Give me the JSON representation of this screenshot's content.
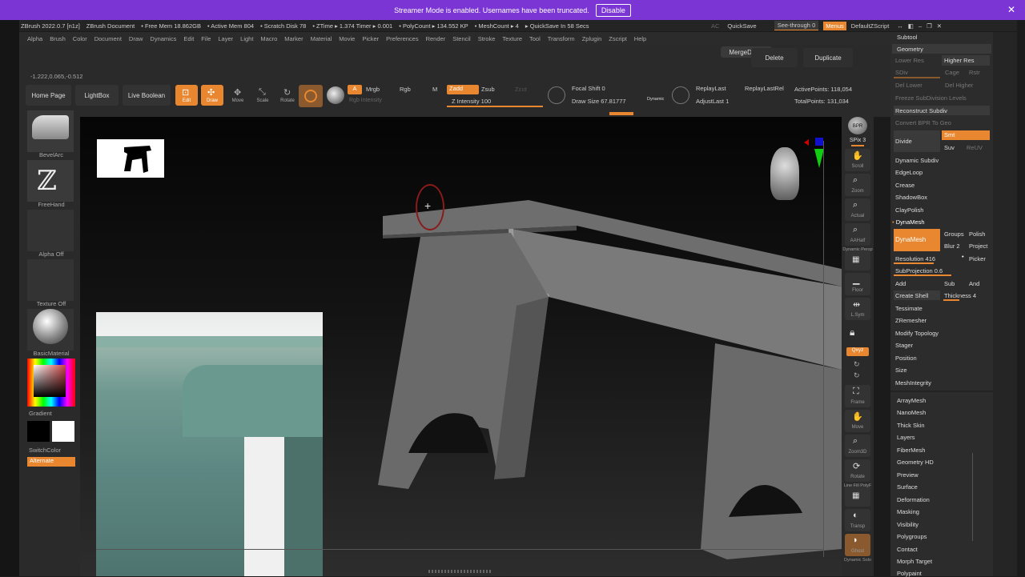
{
  "banner": {
    "message": "Streamer Mode is enabled. Usernames have been truncated.",
    "disable": "Disable"
  },
  "titlebar": {
    "app": "ZBrush 2022.0.7 [n1z]",
    "doc": "ZBrush Document",
    "free_mem": "• Free Mem 18.862GB",
    "active_mem": "• Active Mem 804",
    "scratch": "• Scratch Disk 78",
    "ztime": "• ZTime ▸ 1.374 Timer ▸ 0.001",
    "polycount": "• PolyCount ▸ 134.552 KP",
    "meshcount": "• MeshCount ▸ 4",
    "quicksave": "▸ QuickSave In 58 Secs"
  },
  "topright": {
    "ac": "AC",
    "quicksave": "QuickSave",
    "seethrough": "See-through",
    "seethrough_val": "0",
    "menus": "Menus",
    "script": "DefaultZScript"
  },
  "menus": [
    "Alpha",
    "Brush",
    "Color",
    "Document",
    "Draw",
    "Dynamics",
    "Edit",
    "File",
    "Layer",
    "Light",
    "Macro",
    "Marker",
    "Material",
    "Movie",
    "Picker",
    "Preferences",
    "Render",
    "Stencil",
    "Stroke",
    "Texture",
    "Tool",
    "Transform",
    "Zplugin",
    "Zscript",
    "Help"
  ],
  "coords": "-1.222,0.065,-0.512",
  "shelf": {
    "merge_down": "MergeDown",
    "delete": "Delete",
    "duplicate": "Duplicate",
    "home": "Home Page",
    "lightbox": "LightBox",
    "live_boolean": "Live Boolean",
    "edit": "Edit",
    "draw": "Draw",
    "move": "Move",
    "scale": "Scale",
    "rotate": "Rotate",
    "a": "A",
    "mrgb": "Mrgb",
    "rgb": "Rgb",
    "m": "M",
    "zadd": "Zadd",
    "zsub": "Zsub",
    "zcut": "Zcut",
    "rgb_intensity": "Rgb Intensity",
    "z_intensity": "Z Intensity 100",
    "focal_shift": "Focal Shift 0",
    "draw_size": "Draw Size 67.81777",
    "dynamic": "Dynamic",
    "replay_last": "ReplayLast",
    "replay_last_rel": "ReplayLastRel",
    "adjust_last": "AdjustLast 1",
    "active_points": "ActivePoints: 118,054",
    "total_points": "TotalPoints: 131,034"
  },
  "left": {
    "bevelarc": "BevelArc",
    "freehand": "FreeHand",
    "alpha_off": "Alpha Off",
    "texture_off": "Texture Off",
    "basic_material": "BasicMaterial",
    "gradient": "Gradient",
    "switch_color": "SwitchColor",
    "alternate": "Alternate"
  },
  "rightshelf": {
    "bpr": "BPR",
    "spix": "SPix 3",
    "scroll": "Scroll",
    "zoom": "Zoom",
    "actual": "Actual",
    "aahalf": "AAHalf",
    "dynamic_persp": "Dynamic Persp",
    "floor": "Floor",
    "lsym": "L.Sym",
    "xyz": "Qxyz",
    "frame": "Frame",
    "move": "Move",
    "zoom3d": "Zoom3D",
    "rotate": "Rotate",
    "linefill": "Line Fill PolyF",
    "transp": "Transp",
    "ghost": "Ghost",
    "solo": "Dynamic Solo"
  },
  "tray": {
    "subtool": "Subtool",
    "geometry": "Geometry",
    "lower_res": "Lower Res",
    "higher_res": "Higher Res",
    "sdiv": "SDiv",
    "cage": "Cage",
    "rstr": "Rstr",
    "del_lower": "Del Lower",
    "del_higher": "Del Higher",
    "freeze": "Freeze SubDivision Levels",
    "reconstruct": "Reconstruct Subdiv",
    "convert_bpr": "Convert BPR To Geo",
    "divide": "Divide",
    "smt": "Smt",
    "suv": "Suv",
    "reuv": "ReUV",
    "dynamic_subdiv": "Dynamic Subdiv",
    "edgeloop": "EdgeLoop",
    "crease": "Crease",
    "shadowbox": "ShadowBox",
    "claypolish": "ClayPolish",
    "dynamesh_hdr": "DynaMesh",
    "dynamesh_btn": "DynaMesh",
    "groups": "Groups",
    "polish": "Polish",
    "blur": "Blur 2",
    "project": "Project",
    "resolution": "Resolution 416",
    "picker": "Picker",
    "subprojection": "SubProjection 0.6",
    "add": "Add",
    "sub": "Sub",
    "and": "And",
    "create_shell": "Create Shell",
    "thickness": "Thickness 4",
    "tessimate": "Tessimate",
    "zremesher": "ZRemesher",
    "modify_topology": "Modify Topology",
    "stager": "Stager",
    "position": "Position",
    "size": "Size",
    "meshintegrity": "MeshIntegrity",
    "sections": [
      "ArrayMesh",
      "NanoMesh",
      "Thick Skin",
      "Layers",
      "FiberMesh",
      "Geometry HD",
      "Preview",
      "Surface",
      "Deformation",
      "Masking",
      "Visibility",
      "Polygroups",
      "Contact",
      "Morph Target",
      "Polypaint"
    ]
  },
  "colors": {
    "accent": "#e8872f",
    "banner": "#7a35d4"
  }
}
